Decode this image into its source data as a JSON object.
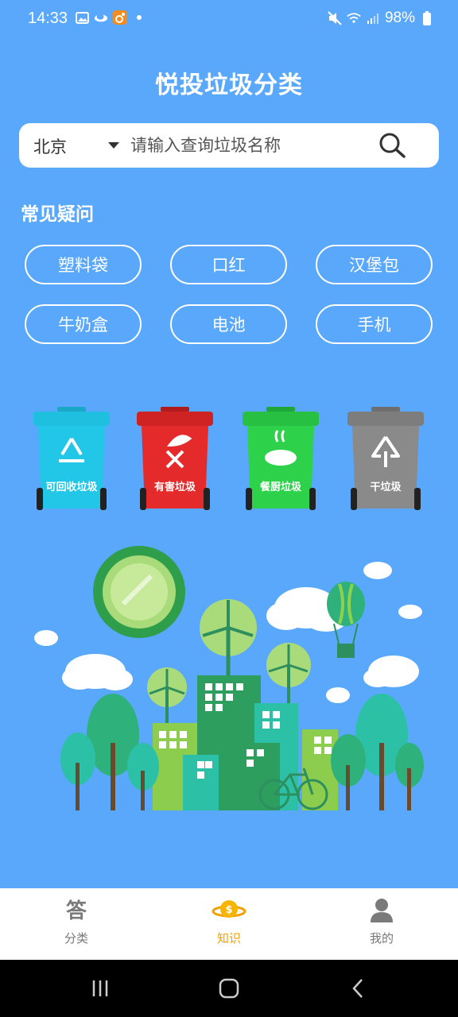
{
  "status": {
    "time": "14:33",
    "battery": "98%"
  },
  "app": {
    "title": "悦投垃圾分类"
  },
  "search": {
    "city": "北京",
    "placeholder": "请输入查询垃圾名称"
  },
  "faq": {
    "title": "常见疑问",
    "items": [
      "塑料袋",
      "口红",
      "汉堡包",
      "牛奶盒",
      "电池",
      "手机"
    ]
  },
  "bins": [
    {
      "label": "可回收垃圾",
      "color": "#22c7e8",
      "icon": "recycle-icon"
    },
    {
      "label": "有害垃圾",
      "color": "#e42a2a",
      "icon": "hazardous-icon"
    },
    {
      "label": "餐厨垃圾",
      "color": "#2ed24a",
      "icon": "kitchen-waste-icon"
    },
    {
      "label": "干垃圾",
      "color": "#8a8a8a",
      "icon": "dry-waste-icon"
    }
  ],
  "nav": {
    "items": [
      {
        "label": "分类",
        "icon": "answer-icon"
      },
      {
        "label": "知识",
        "icon": "coin-planet-icon",
        "active": true
      },
      {
        "label": "我的",
        "icon": "user-icon"
      }
    ],
    "active_color": "#f2a100"
  },
  "colors": {
    "background": "#5aa8fb",
    "accent": "#f2a100"
  }
}
